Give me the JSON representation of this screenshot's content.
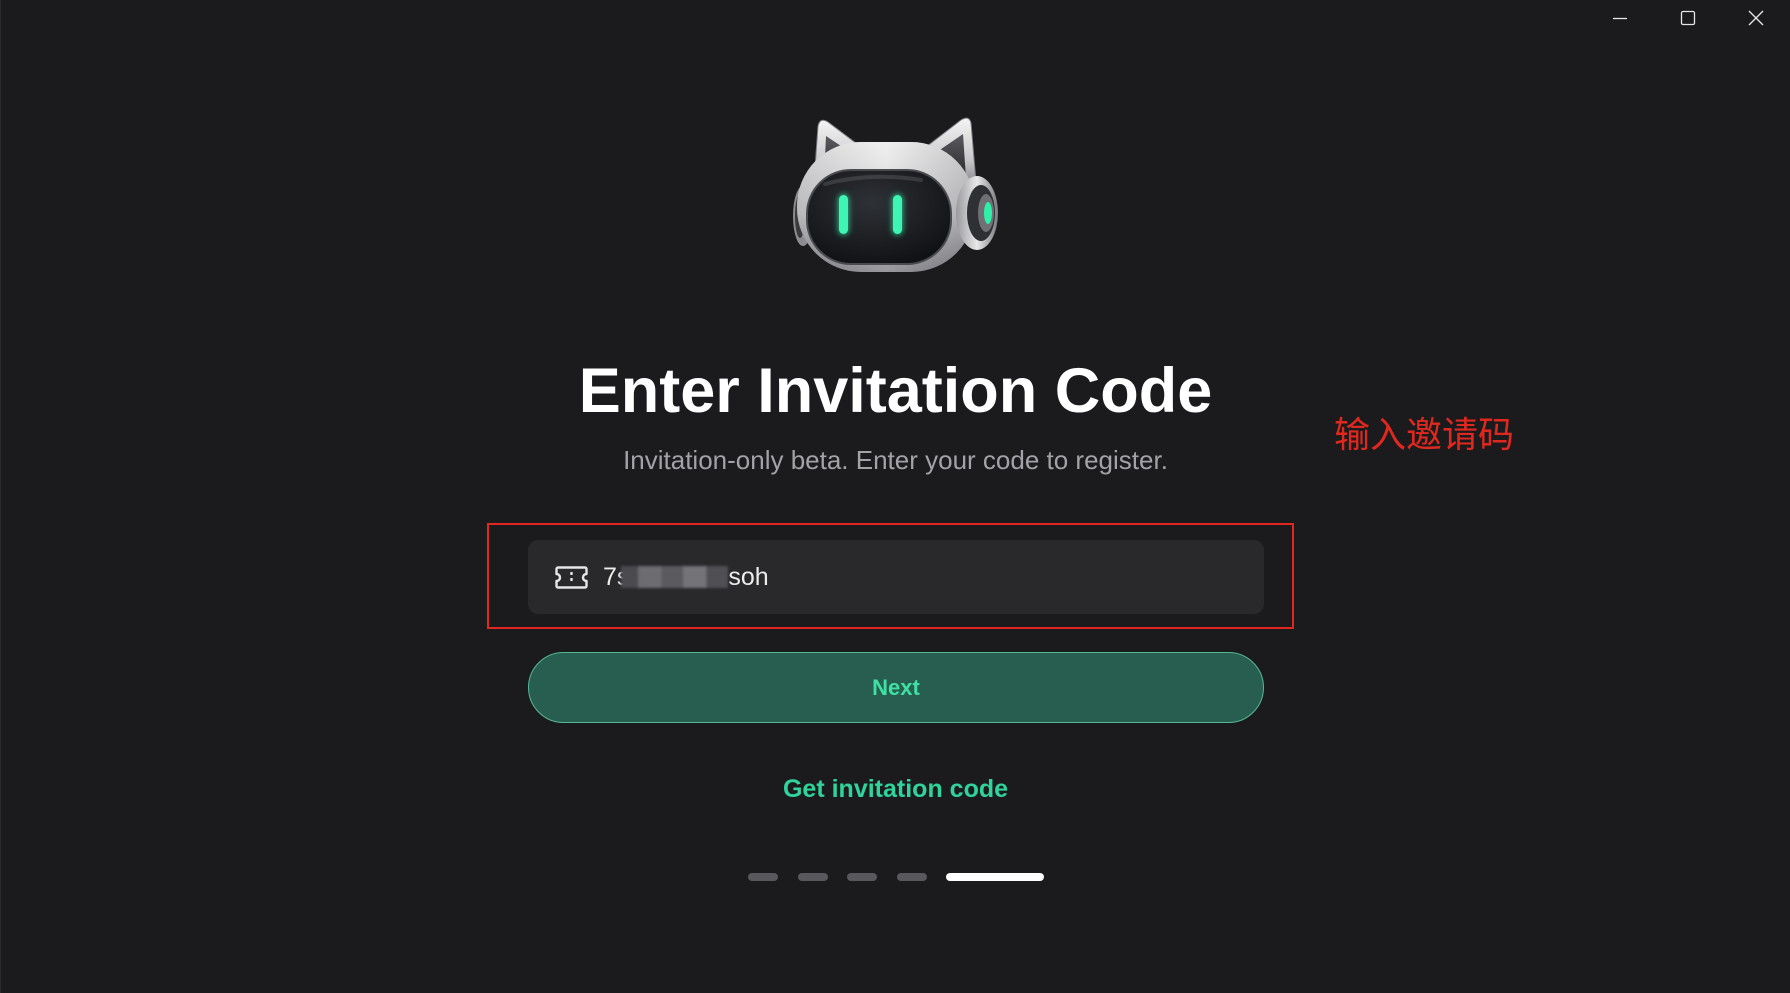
{
  "window_controls": {
    "minimize_icon": "minimize-icon",
    "maximize_icon": "maximize-icon",
    "close_icon": "close-icon"
  },
  "mascot": {
    "icon": "robot-cat-mascot"
  },
  "title": "Enter Invitation Code",
  "subtitle": "Invitation-only beta. Enter your code to register.",
  "annotation": {
    "label": "输入邀请码",
    "color": "#e0281e"
  },
  "code_input": {
    "icon": "ticket-icon",
    "value_prefix": "7s",
    "value_suffix": "soh"
  },
  "next_button": {
    "label": "Next"
  },
  "get_code_link": {
    "label": "Get invitation code"
  },
  "steps": {
    "total": 5,
    "current": 5
  },
  "colors": {
    "background": "#1b1b1e",
    "accent": "#2fd39b",
    "button_bg": "#285e50",
    "input_bg": "#29292c",
    "annotation_red": "#e0281e"
  }
}
